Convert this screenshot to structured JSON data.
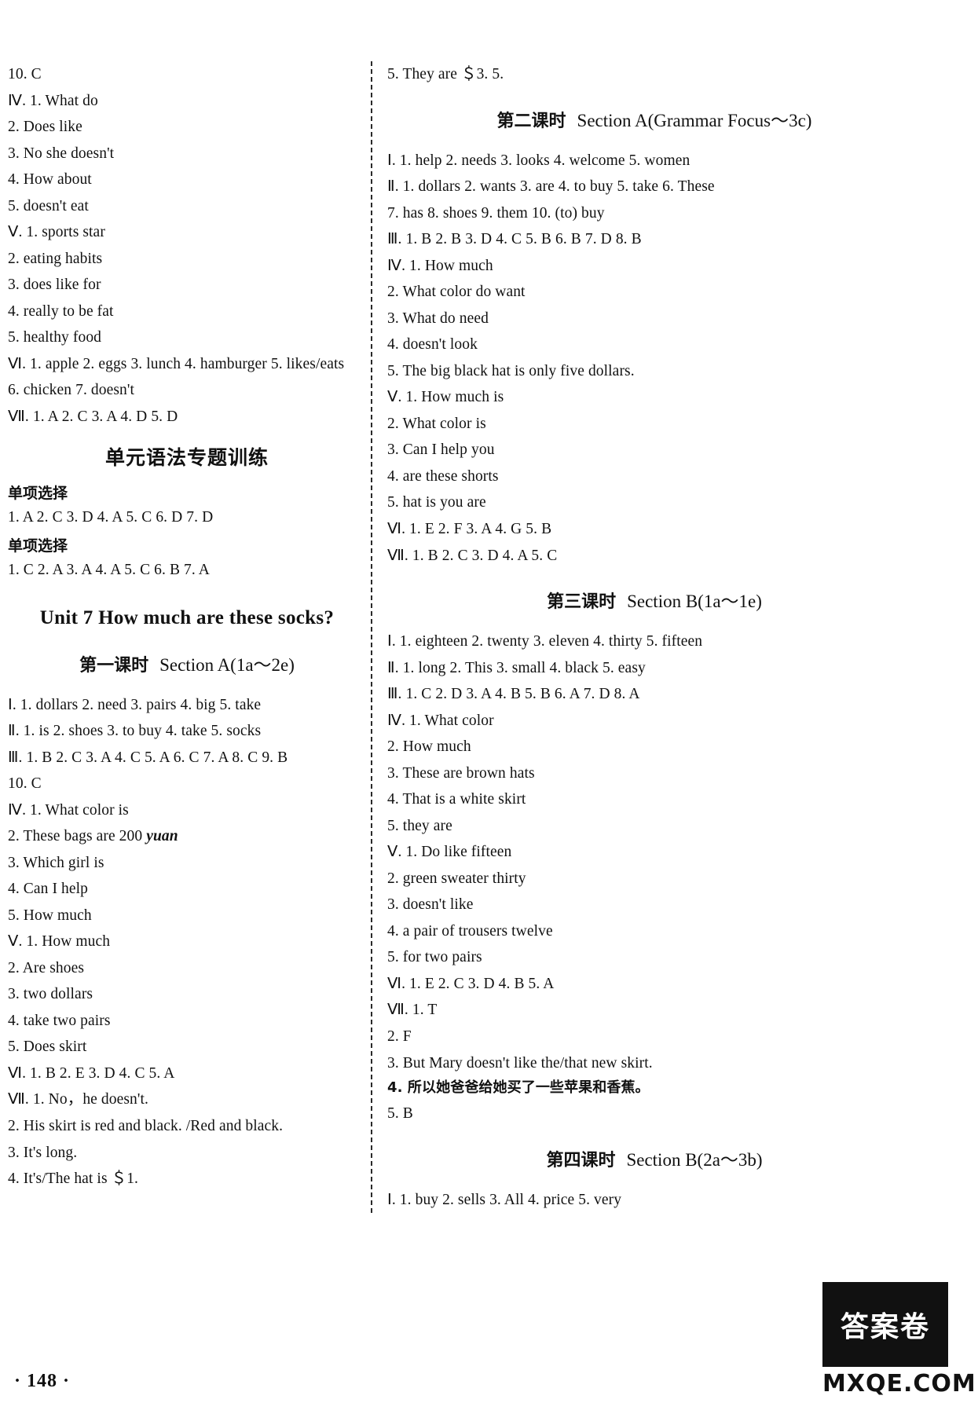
{
  "page": {
    "number": "148",
    "watermark_box": "答案卷",
    "watermark_text": "MXQE.COM"
  },
  "left_column": {
    "prev_unit_answers": [
      "10. C",
      "Ⅳ. 1. What   do",
      "2. Does   like",
      "3. No   she   doesn't",
      "4. How   about",
      "5. doesn't   eat",
      "Ⅴ. 1. sports   star",
      "2. eating   habits",
      "3. does   like   for",
      "4. really   to   be   fat",
      "5. healthy   food",
      "Ⅵ. 1. apple   2. eggs   3. lunch   4. hamburger   5. likes/eats",
      "6. chicken   7. doesn't",
      "Ⅶ. 1. A   2. C   3. A   4. D   5. D"
    ],
    "grammar_section": {
      "heading": "单元语法专题训练",
      "blocks": [
        {
          "label": "单项选择",
          "answers": "1. A   2. C   3. D   4. A   5. C   6. D   7. D"
        },
        {
          "label": "单项选择",
          "answers": "1. C   2. A   3. A   4. A   5. C   6. B   7. A"
        }
      ]
    },
    "unit_title": "Unit 7   How much are these socks?",
    "lesson": {
      "zh": "第一课时",
      "en": "Section A(1a～2e)"
    },
    "lesson_answers": [
      "Ⅰ. 1. dollars   2. need   3. pairs   4. big   5. take",
      "Ⅱ. 1. is   2. shoes   3. to   buy   4. take   5. socks",
      "Ⅲ. 1. B   2. C   3. A   4. C   5. A   6. C   7. A   8. C   9. B",
      "10. C",
      "Ⅳ. 1. What   color   is",
      "2. These   bags   are   200  ",
      "3. Which   girl   is",
      "4. Can   I   help",
      "5. How   much",
      "Ⅴ. 1. How   much",
      "2. Are   shoes",
      "3. two   dollars",
      "4. take   two   pairs",
      "5. Does   skirt",
      "Ⅵ. 1. B   2. E   3. D   4. C   5. A",
      "Ⅶ. 1. No，he doesn't.",
      "2. His skirt is red and black. /Red and black.",
      "3. It's long.",
      "4. It's/The hat is ＄1."
    ],
    "italic_word": "yuan"
  },
  "right_column": {
    "carryover": "5. They are ＄3. 5.",
    "lesson2": {
      "zh": "第二课时",
      "en": "Section A(Grammar Focus～3c)"
    },
    "lesson2_answers": [
      "Ⅰ. 1. help   2. needs   3. looks   4. welcome   5. women",
      "Ⅱ. 1. dollars   2. wants   3. are   4. to buy   5. take   6. These",
      "7. has   8. shoes   9. them   10. (to) buy",
      "Ⅲ. 1. B   2. B   3. D   4. C   5. B   6. B   7. D   8. B",
      "Ⅳ. 1. How   much",
      "2. What   color   do   want",
      "3. What   do   need",
      "4. doesn't   look",
      "5. The big black hat is only five dollars.",
      "Ⅴ. 1. How   much   is",
      "2. What   color   is",
      "3. Can   I   help   you",
      "4. are   these   shorts",
      "5. hat   is   you   are",
      "Ⅵ. 1. E   2. F   3. A   4. G   5. B",
      "Ⅶ. 1. B   2. C   3. D   4. A   5. C"
    ],
    "lesson3": {
      "zh": "第三课时",
      "en": "Section B(1a～1e)"
    },
    "lesson3_answers": [
      "Ⅰ. 1. eighteen   2. twenty   3. eleven   4. thirty   5. fifteen",
      "Ⅱ. 1. long   2. This   3. small   4. black   5. easy",
      "Ⅲ. 1. C   2. D   3. A   4. B   5. B   6. A   7. D   8. A",
      "Ⅳ. 1. What   color",
      "2. How   much",
      "3. These   are   brown   hats",
      "4. That   is   a   white   skirt",
      "5. they   are",
      "Ⅴ. 1. Do   like   fifteen",
      "2. green   sweater   thirty",
      "3. doesn't   like",
      "4. a   pair   of   trousers   twelve",
      "5. for   two   pairs",
      "Ⅵ. 1. E   2. C   3. D   4. B   5. A",
      "Ⅶ. 1. T",
      "2. F",
      "3. But Mary doesn't like the/that new skirt.",
      "4. 所以她爸爸给她买了一些苹果和香蕉。",
      "5. B"
    ],
    "lesson4": {
      "zh": "第四课时",
      "en": "Section B(2a～3b)"
    },
    "lesson4_answers": [
      "Ⅰ. 1. buy   2. sells   3. All   4. price   5. very"
    ]
  }
}
